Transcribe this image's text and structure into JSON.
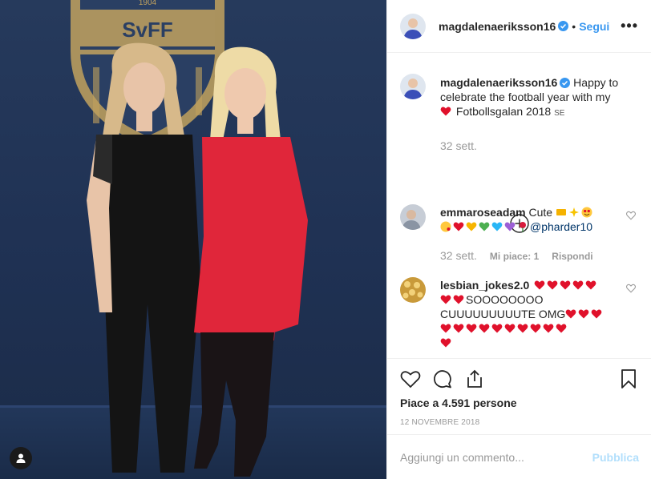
{
  "photo": {
    "crest_year": "1904",
    "crest_text": "SvFF"
  },
  "header": {
    "username": "magdalenaeriksson16",
    "separator": "•",
    "follow_label": "Segui",
    "more_label": "•••"
  },
  "caption": {
    "username": "magdalenaeriksson16",
    "text_before": " Happy to celebrate the football year with my ",
    "text_after": " Fotbollsgalan 2018 ",
    "flag": "SE",
    "time": "32 sett."
  },
  "comments": [
    {
      "username": "emmaroseadam",
      "text_a": " Cute ",
      "mention": "@pharder10",
      "time": "32 sett.",
      "likes": "Mi piace: 1",
      "reply": "Rispondi"
    },
    {
      "username": "lesbian_jokes2.0",
      "text_a": "SOOOOOOOO",
      "text_b": "CUUUUUUUUUTE OMG"
    }
  ],
  "actions": {
    "likes_text": "Piace a 4.591 persone",
    "date": "12 NOVEMBRE 2018"
  },
  "add_comment": {
    "placeholder": "Aggiungi un commento...",
    "publish_label": "Pubblica"
  },
  "colors": {
    "link_blue": "#3897f0",
    "heart_red": "#ed4956",
    "verified_blue": "#3897f0",
    "muted": "#999999"
  }
}
